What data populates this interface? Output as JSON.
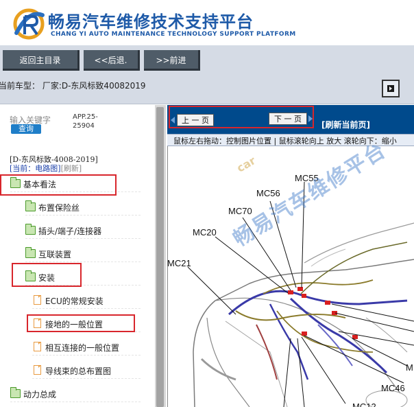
{
  "header": {
    "title": "畅易汽车维修技术支持平台",
    "subtitle": "CHANG YI AUTO MAINTENANCE TECHNOLOGY SUPPORT PLATFORM"
  },
  "nav": {
    "home": "返回主目录",
    "back": "<<后退.",
    "forward": ">>前进"
  },
  "model_bar": {
    "text": "当前车型：  厂家:D-东风标致40082019"
  },
  "left": {
    "search_label": "输入关键字",
    "search_button": "查询",
    "app_version": "APP.25-25904",
    "tree_model": "[D-东风标致-4008-2019]",
    "current_prefix": "[当前：电路图]",
    "refresh": "[刷新]",
    "tree": [
      {
        "label": "基本看法",
        "type": "folder"
      },
      {
        "label": "布置保险丝",
        "type": "folder"
      },
      {
        "label": "插头/端子/连接器",
        "type": "folder"
      },
      {
        "label": "互联装置",
        "type": "folder"
      },
      {
        "label": "安装",
        "type": "folder"
      },
      {
        "label": "ECU的常规安装",
        "type": "doc"
      },
      {
        "label": "接地的一般位置",
        "type": "doc"
      },
      {
        "label": "相互连接的一般位置",
        "type": "doc"
      },
      {
        "label": "导线束的总布置图",
        "type": "doc"
      },
      {
        "label": "动力总成",
        "type": "folder"
      }
    ]
  },
  "right": {
    "prev": "上 一 页",
    "next": "下 一 页",
    "refresh": "[刷新当前页]",
    "hint": "鼠标左右拖动：控制图片位置 | 鼠标滚轮向上 放大  滚轮向下：缩小",
    "watermark": "畅易汽车维修平台",
    "watermark_small": "car",
    "callouts": [
      "MC55",
      "MC56",
      "MC70",
      "MC20",
      "MC21",
      "MC46",
      "M",
      "MC12"
    ]
  },
  "colors": {
    "brand": "#1e5aa8",
    "nav_button": "#4f5c68",
    "pager_bar": "#004a8c",
    "highlight": "#d8262c",
    "search_button": "#1f7ec8"
  }
}
